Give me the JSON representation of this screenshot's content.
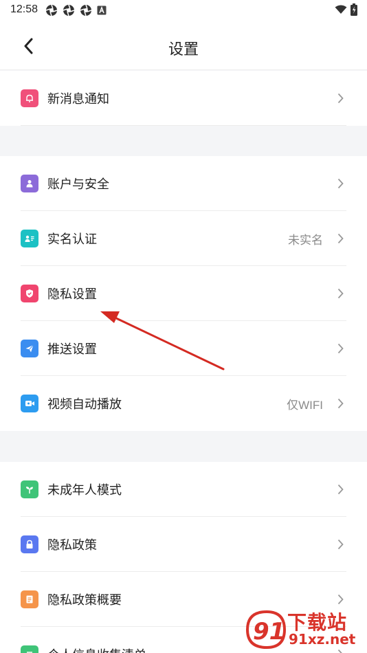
{
  "status_bar": {
    "time": "12:58",
    "left_icons": [
      "aperture-icon",
      "aperture-icon",
      "aperture-icon",
      "a-box-icon"
    ],
    "right_icons": [
      "wifi-icon",
      "battery-charging-icon"
    ]
  },
  "header": {
    "title": "设置",
    "back_icon": "chevron-left-icon"
  },
  "sections": [
    {
      "items": [
        {
          "label": "新消息通知",
          "value": "",
          "icon": "bell-icon",
          "color": "#f0507a"
        }
      ]
    },
    {
      "items": [
        {
          "label": "账户与安全",
          "value": "",
          "icon": "user-icon",
          "color": "#8c6bd9"
        },
        {
          "label": "实名认证",
          "value": "未实名",
          "icon": "id-card-icon",
          "color": "#1cc1c4"
        },
        {
          "label": "隐私设置",
          "value": "",
          "icon": "shield-icon",
          "color": "#f0456e"
        },
        {
          "label": "推送设置",
          "value": "",
          "icon": "paper-plane-icon",
          "color": "#3b8df0"
        },
        {
          "label": "视频自动播放",
          "value": "仅WIFI",
          "icon": "video-icon",
          "color": "#2d9cf0"
        }
      ]
    },
    {
      "items": [
        {
          "label": "未成年人模式",
          "value": "",
          "icon": "sprout-icon",
          "color": "#3fc478"
        },
        {
          "label": "隐私政策",
          "value": "",
          "icon": "lock-icon",
          "color": "#5a78f0"
        },
        {
          "label": "隐私政策概要",
          "value": "",
          "icon": "document-icon",
          "color": "#f5944a"
        },
        {
          "label": "个人信息收集清单",
          "value": "",
          "icon": "list-icon",
          "color": "#3fc478"
        }
      ]
    }
  ],
  "annotation": {
    "type": "red-arrow",
    "target": "隐私设置",
    "color": "#d42a22"
  },
  "watermark": {
    "chinese": "下载站",
    "url": "91xz.net",
    "badge": "91",
    "color": "#d9342b"
  }
}
